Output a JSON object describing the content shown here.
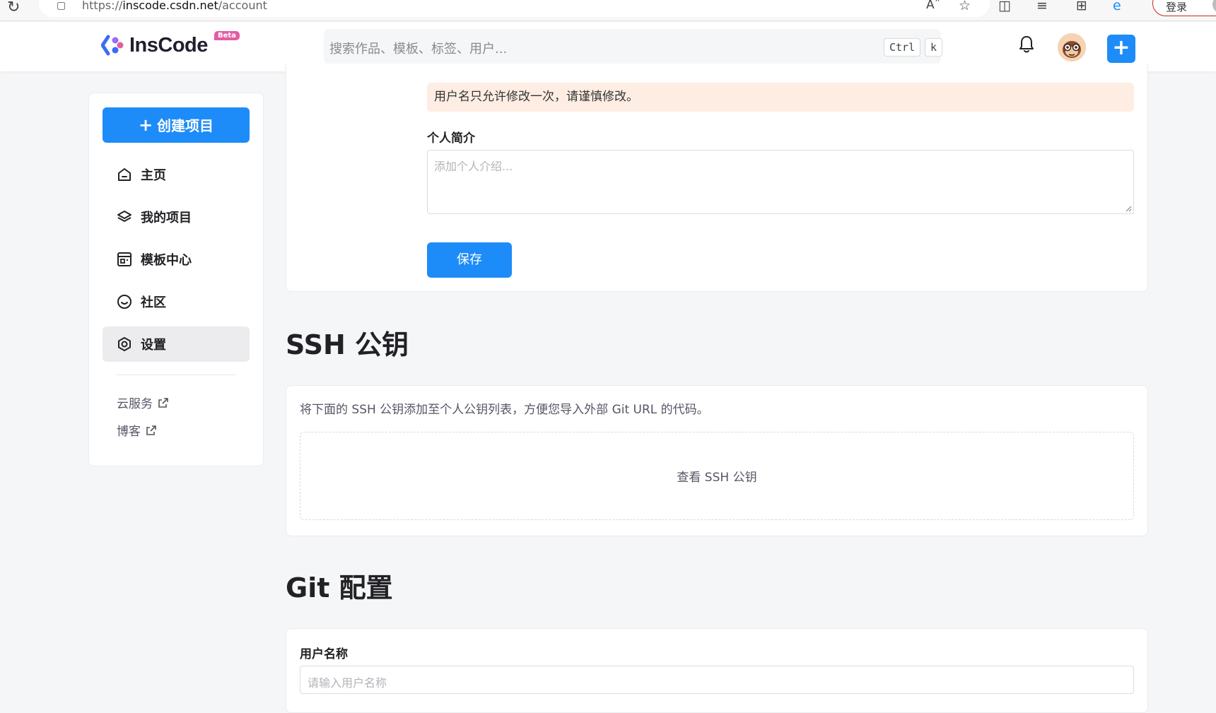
{
  "browser": {
    "url_scheme": "https://",
    "url_host": "inscode.csdn.net",
    "url_path": "/account",
    "login_label": "登录"
  },
  "header": {
    "logo_text": "InsCode",
    "beta_badge": "Beta",
    "search_placeholder": "搜索作品、模板、标签、用户...",
    "shortcut_key1": "Ctrl",
    "shortcut_key2": "k",
    "plus_label": "+"
  },
  "sidebar": {
    "create_label": "创建项目",
    "items": [
      {
        "label": "主页",
        "icon": "home-icon"
      },
      {
        "label": "我的项目",
        "icon": "layers-icon"
      },
      {
        "label": "模板中心",
        "icon": "template-icon"
      },
      {
        "label": "社区",
        "icon": "smile-icon"
      },
      {
        "label": "设置",
        "icon": "settings-icon",
        "active": true
      }
    ],
    "links": [
      {
        "label": "云服务",
        "icon": "external-link-icon"
      },
      {
        "label": "博客",
        "icon": "external-link-icon"
      }
    ]
  },
  "profile": {
    "username_warning": "用户名只允许修改一次，请谨慎修改。",
    "bio_label": "个人简介",
    "bio_placeholder": "添加个人介绍...",
    "save_label": "保存"
  },
  "ssh": {
    "title": "SSH 公钥",
    "description": "将下面的 SSH 公钥添加至个人公钥列表，方便您导入外部 Git URL 的代码。",
    "view_label": "查看 SSH 公钥"
  },
  "git": {
    "title": "Git 配置",
    "username_label": "用户名称",
    "username_placeholder": "请输入用户名称"
  },
  "colors": {
    "primary": "#1d8cf8",
    "warning_bg": "#feede3",
    "page_bg": "#f5f6f7"
  }
}
